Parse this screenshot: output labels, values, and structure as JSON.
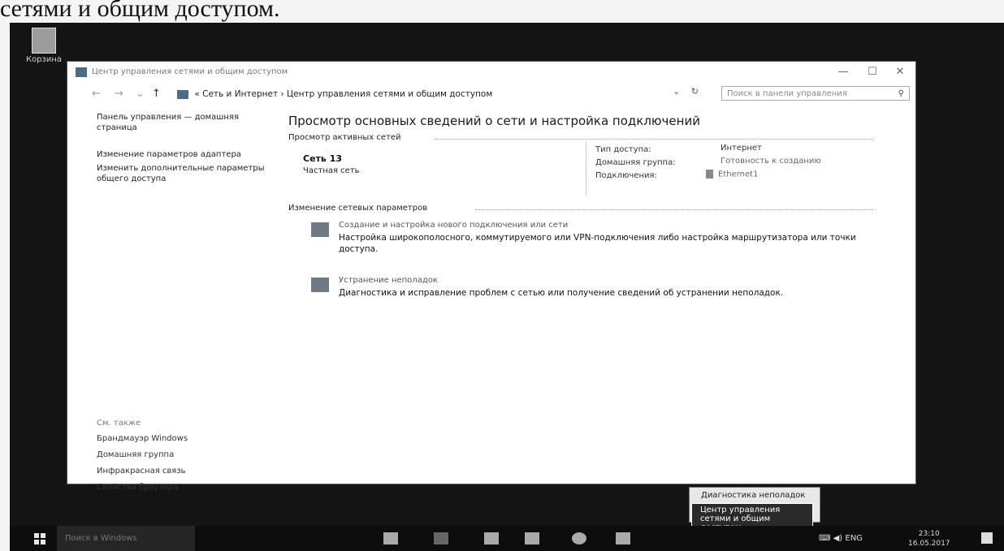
{
  "caption": "сетями и общим доступом.",
  "desktop": {
    "recycle_label": "Корзина"
  },
  "window": {
    "title": "Центр управления сетями и общим доступом",
    "controls": {
      "minimize": "—",
      "maximize": "☐",
      "close": "✕"
    }
  },
  "nav": {
    "back": "←",
    "forward": "→",
    "recent": "⌄",
    "up": "↑"
  },
  "address": {
    "prefix": "«",
    "crumb1": "Сеть и Интернет",
    "sep": "›",
    "crumb2": "Центр управления сетями и общим доступом",
    "dropdown": "⌄",
    "refresh": "↻"
  },
  "search": {
    "placeholder": "Поиск в панели управления",
    "icon": "⚲"
  },
  "sidebar": {
    "home": "Панель управления — домашняя страница",
    "links": [
      "Изменение параметров адаптера",
      "Изменить дополнительные параметры общего доступа"
    ]
  },
  "see_also": {
    "header": "См. также",
    "items": [
      "Брандмауэр Windows",
      "Домашняя группа",
      "Инфракрасная связь",
      "Свойства браузера"
    ]
  },
  "main": {
    "heading": "Просмотр основных сведений о сети и настройка подключений",
    "active_header": "Просмотр активных сетей",
    "network": {
      "name": "Сеть 13",
      "type": "Частная сеть"
    },
    "details": {
      "access_label": "Тип доступа:",
      "access_value": "Интернет",
      "home_label": "Домашняя группа:",
      "home_value": "Готовность к созданию",
      "conn_label": "Подключения:",
      "conn_value": "Ethernet1"
    },
    "change_header": "Изменение сетевых параметров",
    "tasks": [
      {
        "link": "Создание и настройка нового подключения или сети",
        "desc": "Настройка широкополосного, коммутируемого или VPN-подключения либо настройка маршрутизатора или точки доступа."
      },
      {
        "link": "Устранение неполадок",
        "desc": "Диагностика и исправление проблем с сетью или получение сведений об устранении неполадок."
      }
    ]
  },
  "popup": {
    "item1": "Диагностика неполадок",
    "item2": "Центр управления сетями и общим доступом"
  },
  "taskbar": {
    "search_placeholder": "Поиск в Windows",
    "tray": "⌨ ◀) ENG",
    "time": "23:10",
    "date": "16.05.2017"
  }
}
